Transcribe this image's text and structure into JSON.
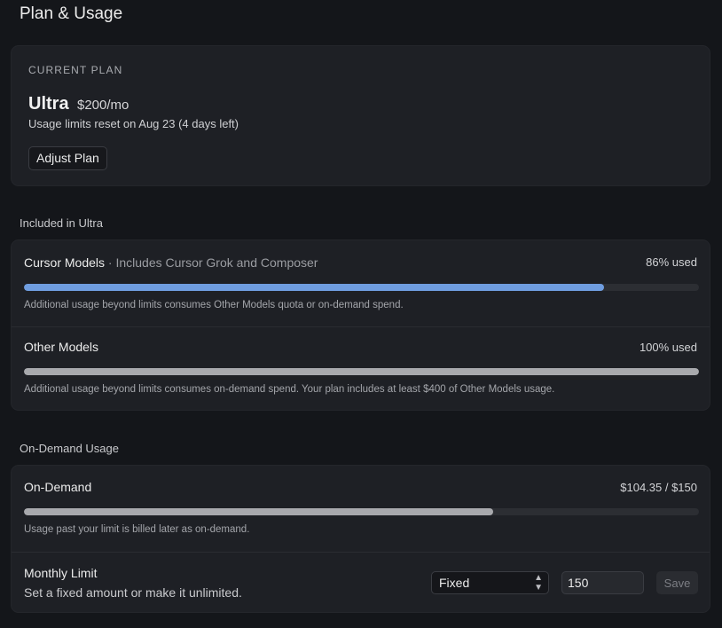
{
  "page": {
    "title": "Plan & Usage"
  },
  "current_plan": {
    "eyebrow": "CURRENT PLAN",
    "name": "Ultra",
    "price": "$200/mo",
    "reset_text": "Usage limits reset on Aug 23 (4 days left)",
    "adjust_label": "Adjust Plan"
  },
  "included": {
    "section_label": "Included in Ultra",
    "cursor_models": {
      "title": "Cursor Models",
      "subtitle": " · Includes Cursor Grok and Composer",
      "used_text": "86% used",
      "used_fraction": 0.86,
      "note": "Additional usage beyond limits consumes Other Models quota or on-demand spend.",
      "bar_color": "#6f9de0"
    },
    "other_models": {
      "title": "Other Models",
      "used_text": "100% used",
      "used_fraction": 1.0,
      "note": "Additional usage beyond limits consumes on-demand spend. Your plan includes at least $400 of Other Models usage.",
      "bar_color": "#a8a9ad"
    }
  },
  "on_demand": {
    "section_label": "On-Demand Usage",
    "usage": {
      "title": "On-Demand",
      "amount_text": "$104.35 / $150",
      "used_fraction": 0.6957,
      "note": "Usage past your limit is billed later as on-demand.",
      "bar_color": "#a8a9ad"
    },
    "monthly_limit": {
      "title": "Monthly Limit",
      "subtitle": "Set a fixed amount or make it unlimited.",
      "mode_value": "Fixed",
      "limit_value": "150",
      "save_label": "Save"
    }
  }
}
